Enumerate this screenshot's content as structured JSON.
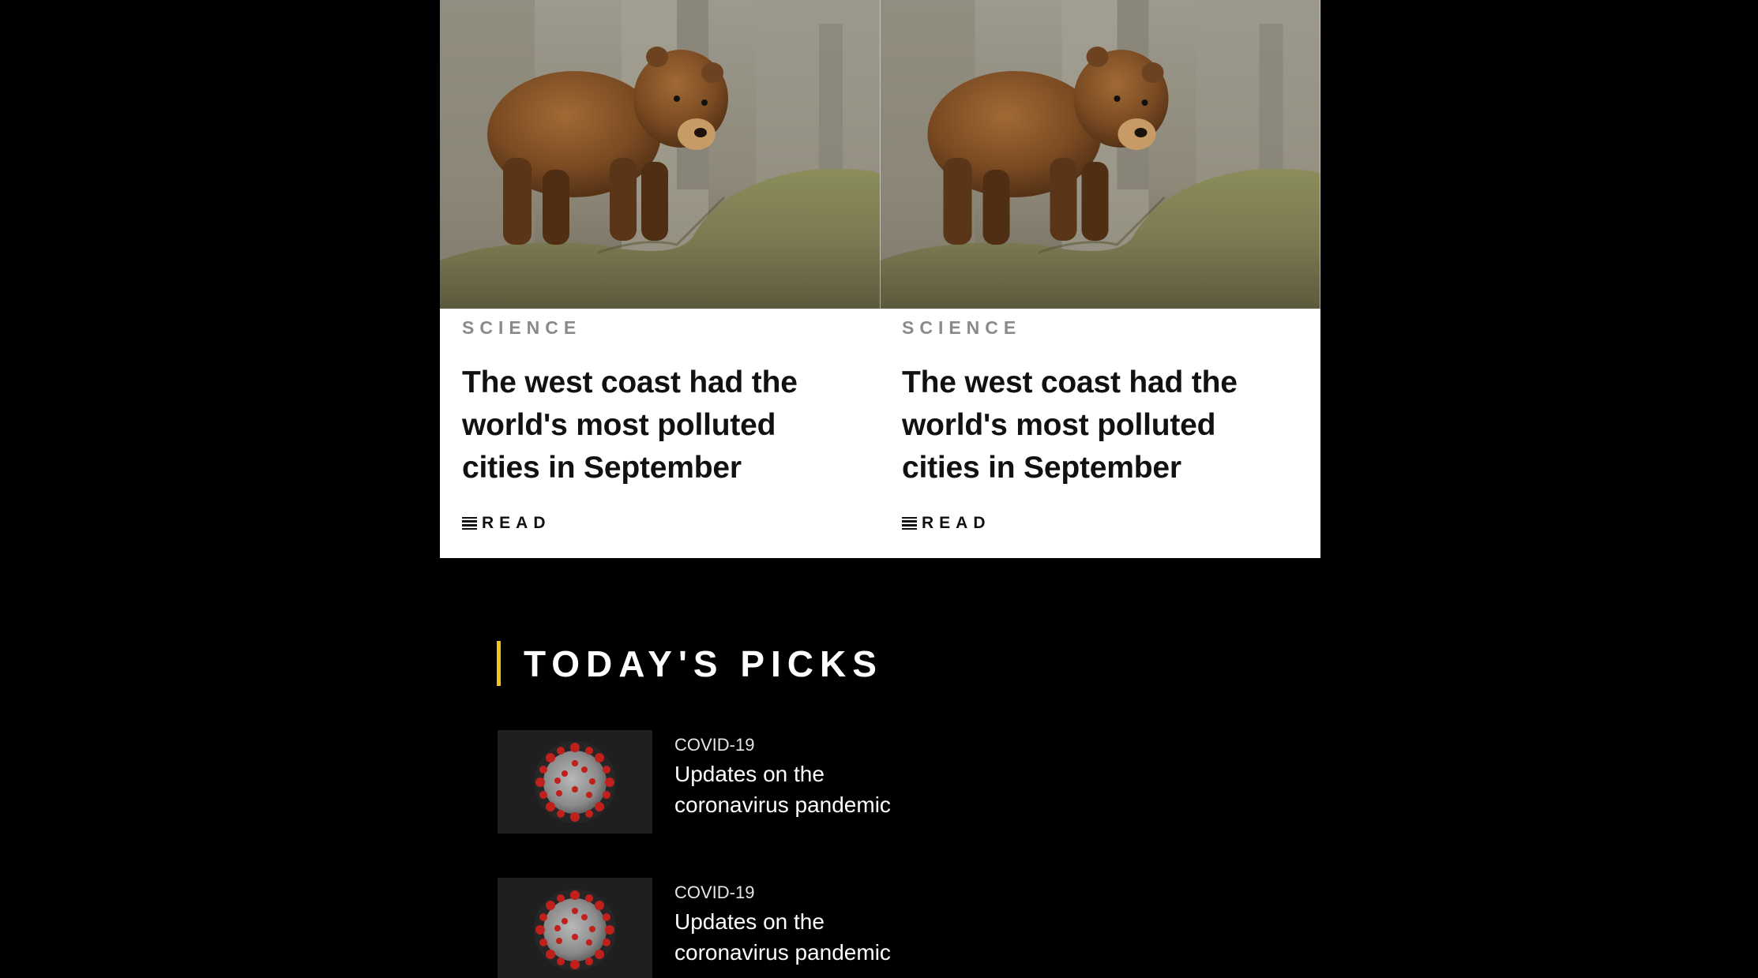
{
  "cards": [
    {
      "image_alt": "brown-bear-on-rock",
      "category": "SCIENCE",
      "title": "The west coast had the world's most polluted cities in September",
      "read_label": "READ"
    },
    {
      "image_alt": "brown-bear-on-rock",
      "category": "SCIENCE",
      "title": "The west coast had the world's most polluted cities in September",
      "read_label": "READ"
    }
  ],
  "picks": {
    "title": "TODAY'S PICKS",
    "accent_color": "#f2c318",
    "items": [
      {
        "kicker": "COVID-19",
        "headline": "Updates on the coronavirus pandemic",
        "thumb_icon": "coronavirus-image"
      },
      {
        "kicker": "COVID-19",
        "headline": "Updates on the coronavirus pandemic",
        "thumb_icon": "coronavirus-image"
      }
    ]
  },
  "colors": {
    "background": "#000000",
    "card_background": "#ffffff",
    "category_text": "#8a8a8a"
  }
}
